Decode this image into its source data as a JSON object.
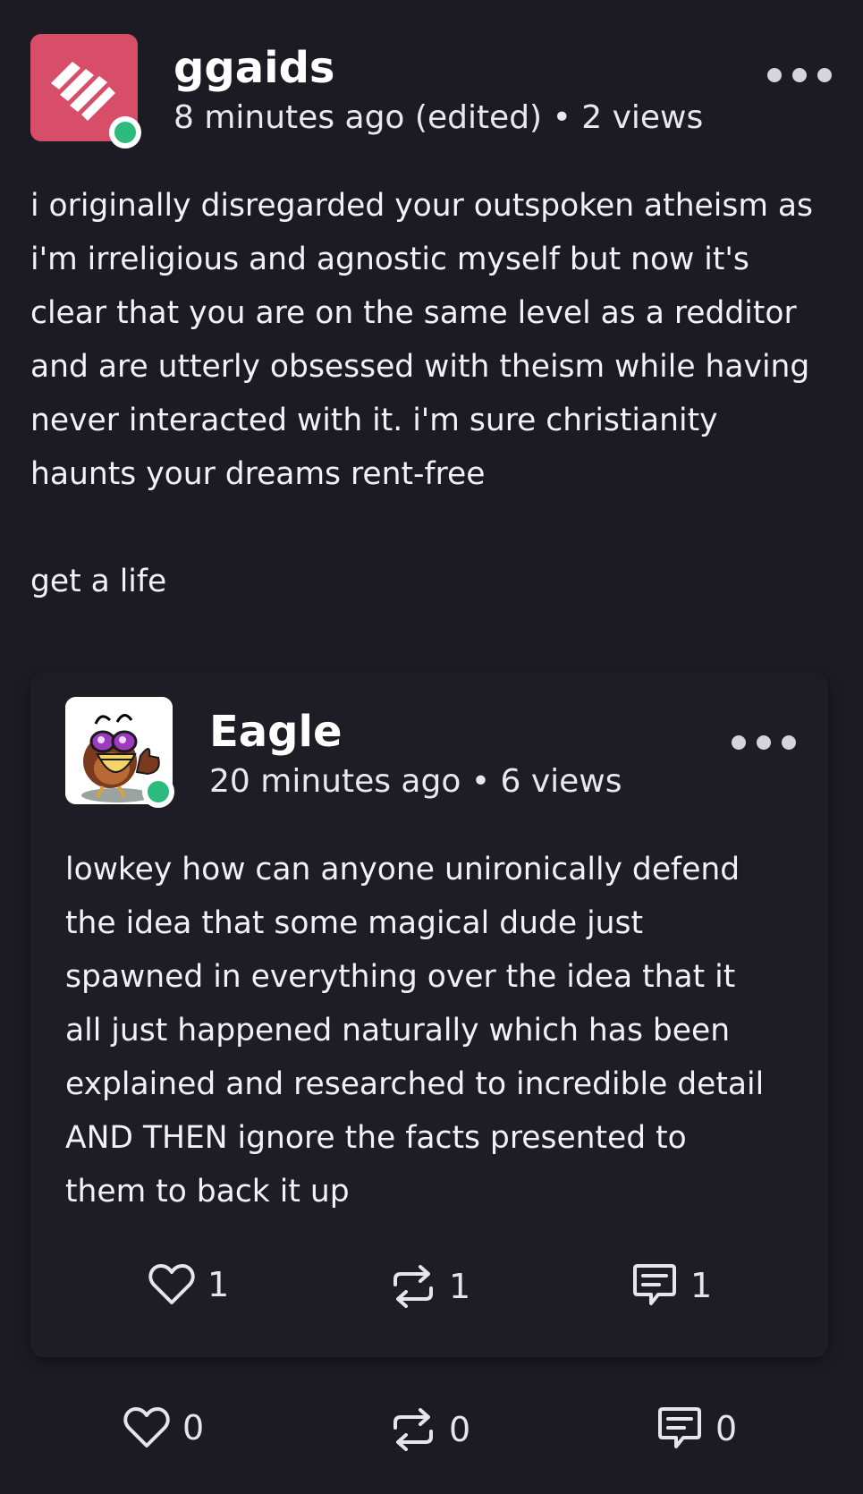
{
  "post": {
    "username": "ggaids",
    "time": "8 minutes ago (edited)",
    "separator": "•",
    "views": "2 views",
    "online": true,
    "text": "i originally disregarded your outspoken atheism as i'm irreligious and agnostic myself but now it's clear that you are on the same level as a redditor and are utterly obsessed with theism while having never interacted with it. i'm sure christianity haunts your dreams rent-free\n\nget a life",
    "avatar_icon": "brand-stripes-logo",
    "avatar_color": "#d84e68",
    "menu_icon": "more-dots-icon",
    "actions": {
      "likes": "0",
      "reposts": "0",
      "comments": "0"
    }
  },
  "quoted_post": {
    "username": "Eagle",
    "time": "20 minutes ago",
    "separator": "•",
    "views": "6 views",
    "online": true,
    "text": "lowkey how can anyone unironically defend the idea that some magical dude just spawned in everything over the idea that it all just happened naturally which has been explained and researched to incredible detail AND THEN ignore the facts presented to them to back it up",
    "avatar_icon": "cartoon-bird-thumbs-up",
    "menu_icon": "more-dots-icon",
    "actions": {
      "likes": "1",
      "reposts": "1",
      "comments": "1"
    }
  },
  "colors": {
    "background": "#1c1b23",
    "online_dot": "#2dba7e",
    "text": "#ecebf0"
  },
  "icons": {
    "like": "heart-icon",
    "repost": "repost-icon",
    "comment": "comment-icon"
  }
}
